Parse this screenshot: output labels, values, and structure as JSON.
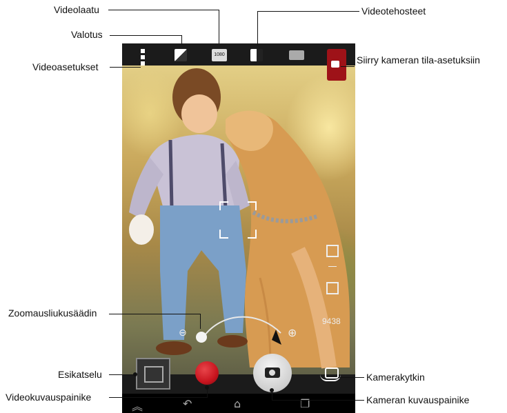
{
  "labels": {
    "video_quality": "Videolaatu",
    "video_effects": "Videotehosteet",
    "exposure": "Valotus",
    "video_settings": "Videoasetukset",
    "switch_mode": "Siirry kameran tila-asetuksiin",
    "zoom_slider": "Zoomausliukusäädin",
    "preview": "Esikatselu",
    "camera_switch": "Kamerakytkin",
    "video_capture": "Videokuvauspainike",
    "camera_capture": "Kameran kuvauspainike"
  },
  "screen": {
    "counter": "9438",
    "quality_badge": "1080",
    "zoom_minus": "⊖",
    "zoom_plus": "⊕"
  },
  "icons": {
    "top": [
      "settings-icon",
      "exposure-icon",
      "video-quality-icon",
      "video-effects-icon",
      "scene-icon",
      "mode-switch-icon"
    ],
    "bottom": [
      "preview-thumbnail",
      "record-icon",
      "camera-shutter-icon",
      "switch-camera-icon"
    ],
    "nav": [
      "back-icon",
      "home-icon",
      "recent-apps-icon"
    ]
  },
  "colors": {
    "record": "#c8141e",
    "mode_switch": "#9e1218"
  }
}
